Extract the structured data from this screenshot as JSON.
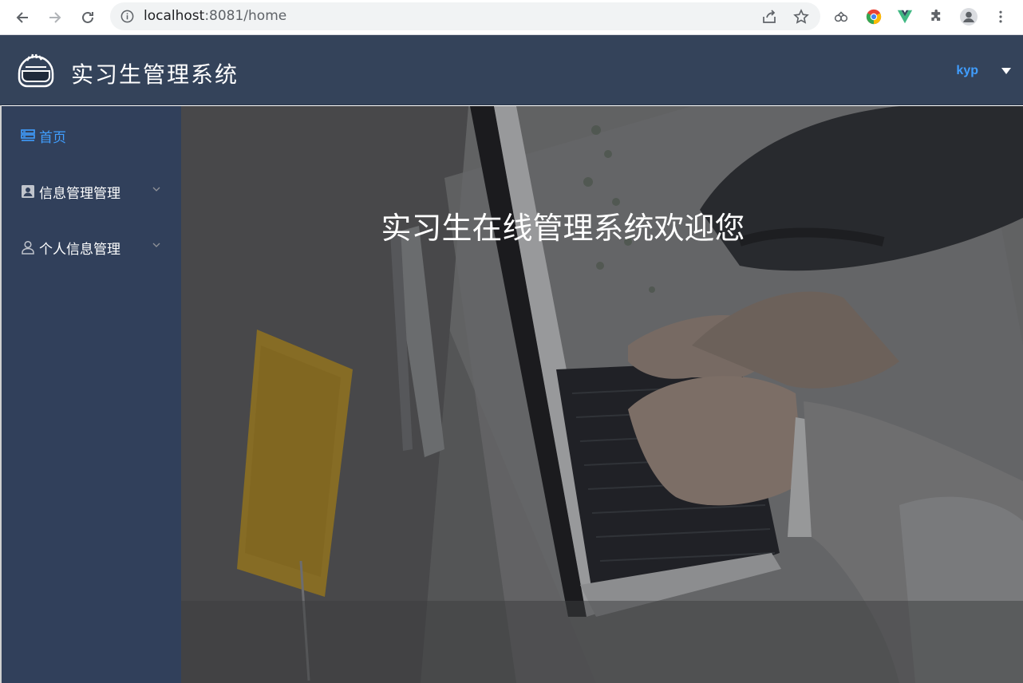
{
  "browser": {
    "url_host": "localhost",
    "url_rest": ":8081/home",
    "icons": [
      "back-icon",
      "forward-icon",
      "reload-icon",
      "info-icon",
      "share-icon",
      "star-icon",
      "extension-link-icon",
      "chrome-color-icon",
      "vue-devtools-icon",
      "puzzle-icon",
      "profile-icon",
      "more-vert-icon"
    ]
  },
  "header": {
    "title": "实习生管理系统",
    "user": "kyp",
    "colors": {
      "background": "#34435a",
      "user": "#409eff"
    }
  },
  "sidebar": {
    "items": [
      {
        "label": "首页",
        "icon": "server-icon",
        "active": true
      },
      {
        "label": "信息管理管理",
        "icon": "contact-card-icon",
        "expandable": true
      },
      {
        "label": "个人信息管理",
        "icon": "user-icon",
        "expandable": true
      }
    ],
    "colors": {
      "background": "#31405b",
      "active": "#409eff"
    }
  },
  "main": {
    "welcome": "实习生在线管理系统欢迎您",
    "background_image": "person-typing-on-laptop-photo"
  }
}
